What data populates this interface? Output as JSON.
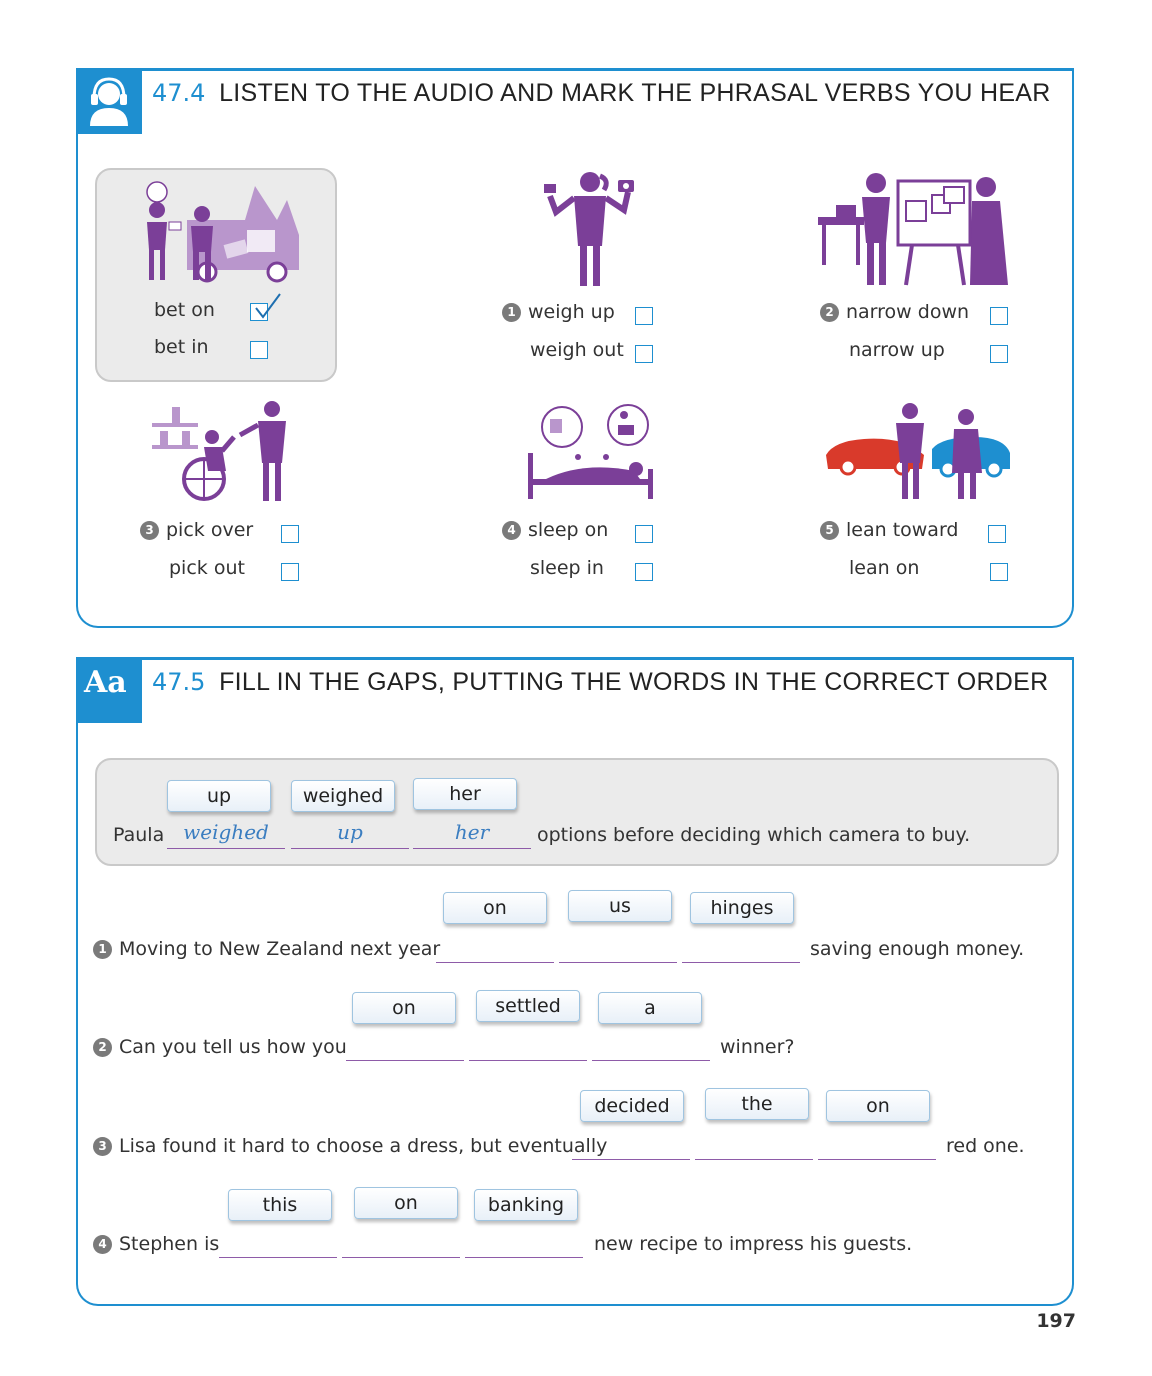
{
  "section1": {
    "number": "47.4",
    "title": "LISTEN TO THE AUDIO AND MARK THE PHRASAL VERBS YOU HEAR",
    "example": {
      "option_a": "bet on",
      "option_b": "bet in",
      "checked": "bet on"
    },
    "items": [
      {
        "num": "1",
        "option_a": "weigh up",
        "option_b": "weigh out"
      },
      {
        "num": "2",
        "option_a": "narrow down",
        "option_b": "narrow up"
      },
      {
        "num": "3",
        "option_a": "pick over",
        "option_b": "pick out"
      },
      {
        "num": "4",
        "option_a": "sleep on",
        "option_b": "sleep in"
      },
      {
        "num": "5",
        "option_a": "lean toward",
        "option_b": "lean on"
      }
    ]
  },
  "section2": {
    "icon_text": "Aa",
    "number": "47.5",
    "title": "FILL IN THE GAPS, PUTTING THE WORDS IN THE CORRECT ORDER",
    "example": {
      "words": [
        "up",
        "weighed",
        "her"
      ],
      "before": "Paula",
      "answers": [
        "weighed",
        "up",
        "her"
      ],
      "after": "options before deciding which camera to buy."
    },
    "items": [
      {
        "num": "1",
        "words": [
          "on",
          "us",
          "hinges"
        ],
        "before": "Moving to New Zealand next year",
        "after": "saving enough money."
      },
      {
        "num": "2",
        "words": [
          "on",
          "settled",
          "a"
        ],
        "before": "Can you tell us how you",
        "after": "winner?"
      },
      {
        "num": "3",
        "words": [
          "decided",
          "the",
          "on"
        ],
        "before": "Lisa found it hard to choose a dress, but eventually",
        "after": "red one."
      },
      {
        "num": "4",
        "words": [
          "this",
          "on",
          "banking"
        ],
        "before": "Stephen is",
        "after": "new recipe to impress his guests."
      }
    ]
  },
  "page_number": "197",
  "colors": {
    "accent": "#1e8fd0",
    "illustration": "#7b3f98",
    "answer": "#3a7dc0"
  }
}
